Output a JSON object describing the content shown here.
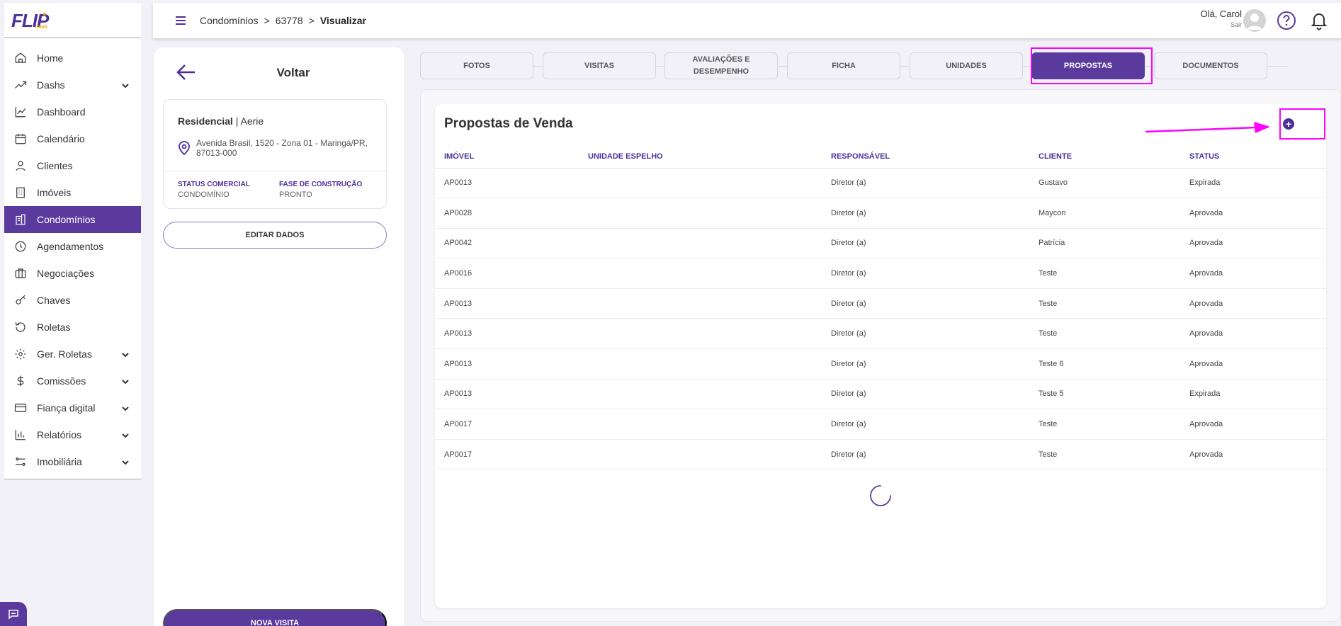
{
  "sidebar": {
    "logo": {
      "main": "FLIP",
      "sub": "imob"
    },
    "items": [
      {
        "label": "Home",
        "icon": "home-icon",
        "expandable": false,
        "active": false
      },
      {
        "label": "Dashs",
        "icon": "trend-icon",
        "expandable": true,
        "active": false
      },
      {
        "label": "Dashboard",
        "icon": "chart-line-icon",
        "expandable": false,
        "active": false
      },
      {
        "label": "Calendário",
        "icon": "calendar-icon",
        "expandable": false,
        "active": false
      },
      {
        "label": "Clientes",
        "icon": "user-icon",
        "expandable": false,
        "active": false
      },
      {
        "label": "Imóveis",
        "icon": "building-icon",
        "expandable": false,
        "active": false
      },
      {
        "label": "Condomínios",
        "icon": "condo-icon",
        "expandable": false,
        "active": true
      },
      {
        "label": "Agendamentos",
        "icon": "clock-icon",
        "expandable": false,
        "active": false
      },
      {
        "label": "Negociações",
        "icon": "briefcase-icon",
        "expandable": false,
        "active": false
      },
      {
        "label": "Chaves",
        "icon": "key-icon",
        "expandable": false,
        "active": false
      },
      {
        "label": "Roletas",
        "icon": "rotate-icon",
        "expandable": false,
        "active": false
      },
      {
        "label": "Ger. Roletas",
        "icon": "gear-icon",
        "expandable": true,
        "active": false
      },
      {
        "label": "Comissões",
        "icon": "dollar-icon",
        "expandable": true,
        "active": false
      },
      {
        "label": "Fiança digital",
        "icon": "card-icon",
        "expandable": true,
        "active": false
      },
      {
        "label": "Relatórios",
        "icon": "bar-chart-icon",
        "expandable": true,
        "active": false
      },
      {
        "label": "Imobiliária",
        "icon": "sliders-icon",
        "expandable": true,
        "active": false
      }
    ]
  },
  "header": {
    "breadcrumb": [
      "Condomínios",
      "63778",
      "Visualizar"
    ],
    "greeting": "Olá, Carol",
    "logout": "Sair"
  },
  "left_panel": {
    "back_label": "Voltar",
    "type": "Residencial",
    "name": "Aerie",
    "address": "Avenida Brasil, 1520 - Zona 01 - Maringá/PR, 87013-000",
    "status_label": "STATUS COMERCIAL",
    "status_value": "CONDOMÍNIO",
    "phase_label": "FASE DE CONSTRUÇÃO",
    "phase_value": "PRONTO",
    "edit_button": "EDITAR DADOS",
    "new_visit_button": "NOVA VISITA"
  },
  "tabs": [
    {
      "label": "FOTOS",
      "active": false
    },
    {
      "label": "VISITAS",
      "active": false
    },
    {
      "label": "AVALIAÇÕES E DESEMPENHO",
      "active": false
    },
    {
      "label": "FICHA",
      "active": false
    },
    {
      "label": "UNIDADES",
      "active": false
    },
    {
      "label": "PROPOSTAS",
      "active": true
    },
    {
      "label": "DOCUMENTOS",
      "active": false
    }
  ],
  "proposals": {
    "title": "Propostas de Venda",
    "columns": [
      "IMÓVEL",
      "UNIDADE ESPELHO",
      "RESPONSÁVEL",
      "CLIENTE",
      "STATUS"
    ],
    "rows": [
      [
        "AP0013",
        "",
        "Diretor (a)",
        "Gustavo",
        "Expirada"
      ],
      [
        "AP0028",
        "",
        "Diretor (a)",
        "Maycon",
        "Aprovada"
      ],
      [
        "AP0042",
        "",
        "Diretor (a)",
        "Patrícia",
        "Aprovada"
      ],
      [
        "AP0016",
        "",
        "Diretor (a)",
        "Teste",
        "Aprovada"
      ],
      [
        "AP0013",
        "",
        "Diretor (a)",
        "Teste",
        "Aprovada"
      ],
      [
        "AP0013",
        "",
        "Diretor (a)",
        "Teste",
        "Aprovada"
      ],
      [
        "AP0013",
        "",
        "Diretor (a)",
        "Teste 6",
        "Aprovada"
      ],
      [
        "AP0013",
        "",
        "Diretor (a)",
        "Teste 5",
        "Expirada"
      ],
      [
        "AP0017",
        "",
        "Diretor (a)",
        "Teste",
        "Aprovada"
      ],
      [
        "AP0017",
        "",
        "Diretor (a)",
        "Teste",
        "Aprovada"
      ]
    ]
  },
  "colors": {
    "brand": "#5b3a9e",
    "highlight": "#ff00ff"
  }
}
